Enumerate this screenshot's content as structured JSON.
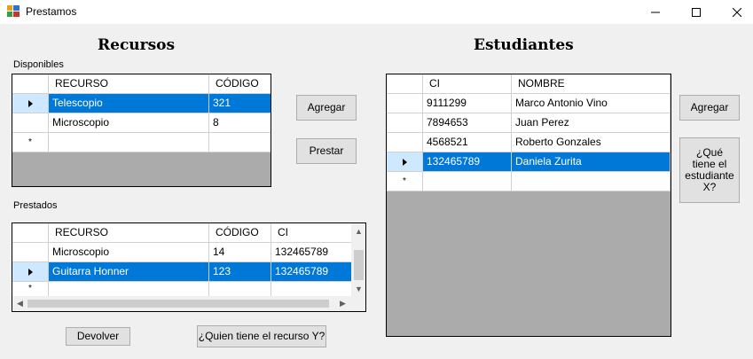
{
  "window": {
    "title": "Prestamos",
    "minimize": "—",
    "maximize": "☐",
    "close": "✕"
  },
  "recursos": {
    "title": "Recursos",
    "disponibles_label": "Disponibles",
    "columns": [
      "RECURSO",
      "CÓDIGO"
    ],
    "rows": [
      {
        "recurso": "Telescopio",
        "codigo": "321",
        "selected": true
      },
      {
        "recurso": "Microscopio",
        "codigo": "8",
        "selected": false
      }
    ],
    "agregar_label": "Agregar",
    "prestar_label": "Prestar",
    "prestados_label": "Prestados",
    "prestados_columns": [
      "RECURSO",
      "CÓDIGO",
      "CI"
    ],
    "prestados_rows": [
      {
        "recurso": "Microscopio",
        "codigo": "14",
        "ci": "132465789",
        "selected": false
      },
      {
        "recurso": "Guitarra Honner",
        "codigo": "123",
        "ci": "132465789",
        "selected": true
      }
    ],
    "devolver_label": "Devolver",
    "quien_label": "¿Quien tiene el recurso Y?"
  },
  "estudiantes": {
    "title": "Estudiantes",
    "columns": [
      "CI",
      "NOMBRE"
    ],
    "rows": [
      {
        "ci": "9111299",
        "nombre": "Marco Antonio Vino",
        "selected": false
      },
      {
        "ci": "7894653",
        "nombre": "Juan Perez",
        "selected": false
      },
      {
        "ci": "4568521",
        "nombre": "Roberto Gonzales",
        "selected": false
      },
      {
        "ci": "132465789",
        "nombre": "Daniela Zurita",
        "selected": true
      }
    ],
    "agregar_label": "Agregar",
    "que_tiene_label": "¿Qué tiene el estudiante X?"
  },
  "scroll_icons": {
    "up": "▲",
    "down": "▼",
    "left": "◀",
    "right": "▶"
  },
  "new_row_glyph": "*"
}
